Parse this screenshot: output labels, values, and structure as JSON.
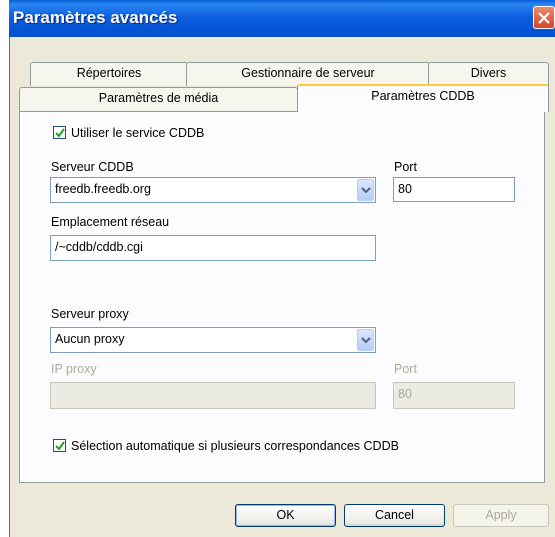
{
  "window": {
    "title": "Paramètres avancés"
  },
  "tabs_row1": [
    {
      "label": "Répertoires"
    },
    {
      "label": "Gestionnaire de serveur"
    },
    {
      "label": "Divers"
    }
  ],
  "tabs_row2": [
    {
      "label": "Paramètres de média"
    },
    {
      "label": "Paramètres CDDB",
      "active": true
    }
  ],
  "cddb": {
    "use_service": {
      "label": "Utiliser le service CDDB",
      "checked": true
    },
    "server": {
      "label": "Serveur CDDB",
      "value": "freedb.freedb.org"
    },
    "port": {
      "label": "Port",
      "value": "80"
    },
    "location": {
      "label": "Emplacement réseau",
      "value": "/~cddb/cddb.cgi"
    },
    "proxy_server": {
      "label": "Serveur proxy",
      "value": "Aucun proxy"
    },
    "proxy_ip": {
      "label": "IP proxy",
      "value": ""
    },
    "proxy_port": {
      "label": "Port",
      "value": "80"
    },
    "auto_select": {
      "label": "Sélection automatique si plusieurs correspondances CDDB",
      "checked": true
    }
  },
  "buttons": {
    "ok": "OK",
    "cancel": "Cancel",
    "apply": "Apply"
  }
}
